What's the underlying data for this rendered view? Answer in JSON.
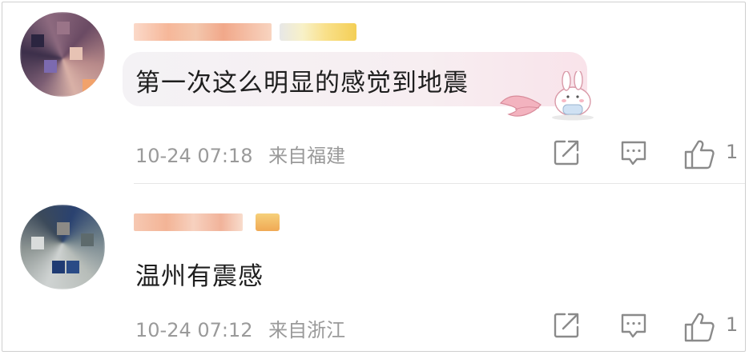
{
  "comments": [
    {
      "text": "第一次这么明显的感觉到地震",
      "time": "10-24 07:18",
      "location": "来自福建",
      "likes": "1"
    },
    {
      "text": "温州有震感",
      "time": "10-24 07:12",
      "location": "来自浙江",
      "likes": "1"
    }
  ],
  "icons": {
    "share": "share-icon",
    "comment": "comment-icon",
    "like": "thumbs-up-icon"
  },
  "colors": {
    "text": "#1e1e1e",
    "meta": "#9a9a9a",
    "icon": "#8a8a8a",
    "bubble": "#f7eef1"
  }
}
